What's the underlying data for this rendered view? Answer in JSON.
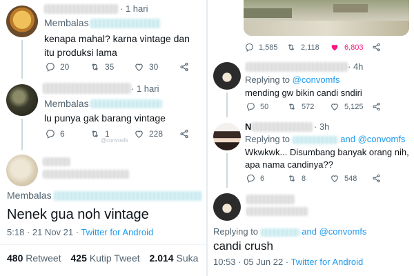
{
  "left": {
    "reply1": {
      "time": "· 1 hari",
      "replying_prefix": "Membalas",
      "text": "kenapa mahal? karna vintage dan itu produksi lama",
      "replies": "20",
      "retweets": "35",
      "likes": "30"
    },
    "reply2": {
      "time": "· 1 hari",
      "replying_prefix": "Membalas",
      "text": "lu punya gak barang vintage",
      "replies": "6",
      "retweets": "1",
      "likes": "228",
      "watermark": "@convosfs"
    },
    "main_tweet": {
      "replying_prefix": "Membalas",
      "text": "Nenek gua noh vintage",
      "timestamp": "5:18 · 21 Nov 21 · ",
      "client": "Twitter for Android",
      "stats": {
        "retweets_count": "480",
        "retweets_label": "Retweet",
        "quotes_count": "425",
        "quotes_label": "Kutip Tweet",
        "likes_count": "2.014",
        "likes_label": "Suka"
      }
    }
  },
  "right": {
    "top_tweet": {
      "replies": "1,585",
      "retweets": "2,118",
      "likes": "6,803",
      "like_color": "#f91880"
    },
    "reply1": {
      "time": "· 4h",
      "replying_prefix": "Replying to",
      "mention": "@convomfs",
      "text": "mending gw bikin candi sndiri",
      "replies": "50",
      "retweets": "572",
      "likes": "5,125"
    },
    "reply2": {
      "name_visible": "N",
      "time": "· 3h",
      "replying_prefix": "Replying to",
      "and_mention": "and @convomfs",
      "text": "Wkwkwk... Disumbang banyak orang nih, apa nama candinya??",
      "replies": "6",
      "retweets": "8",
      "likes": "548"
    },
    "main_tweet": {
      "replying_prefix": "Replying to",
      "and_mention": "and @convomfs",
      "text": "candi crush",
      "timestamp": "10:53 · 05 Jun 22 · ",
      "client": "Twitter for Android"
    }
  },
  "colors": {
    "link": "#1d9bf0",
    "muted": "#536471",
    "like_active": "#f91880"
  }
}
